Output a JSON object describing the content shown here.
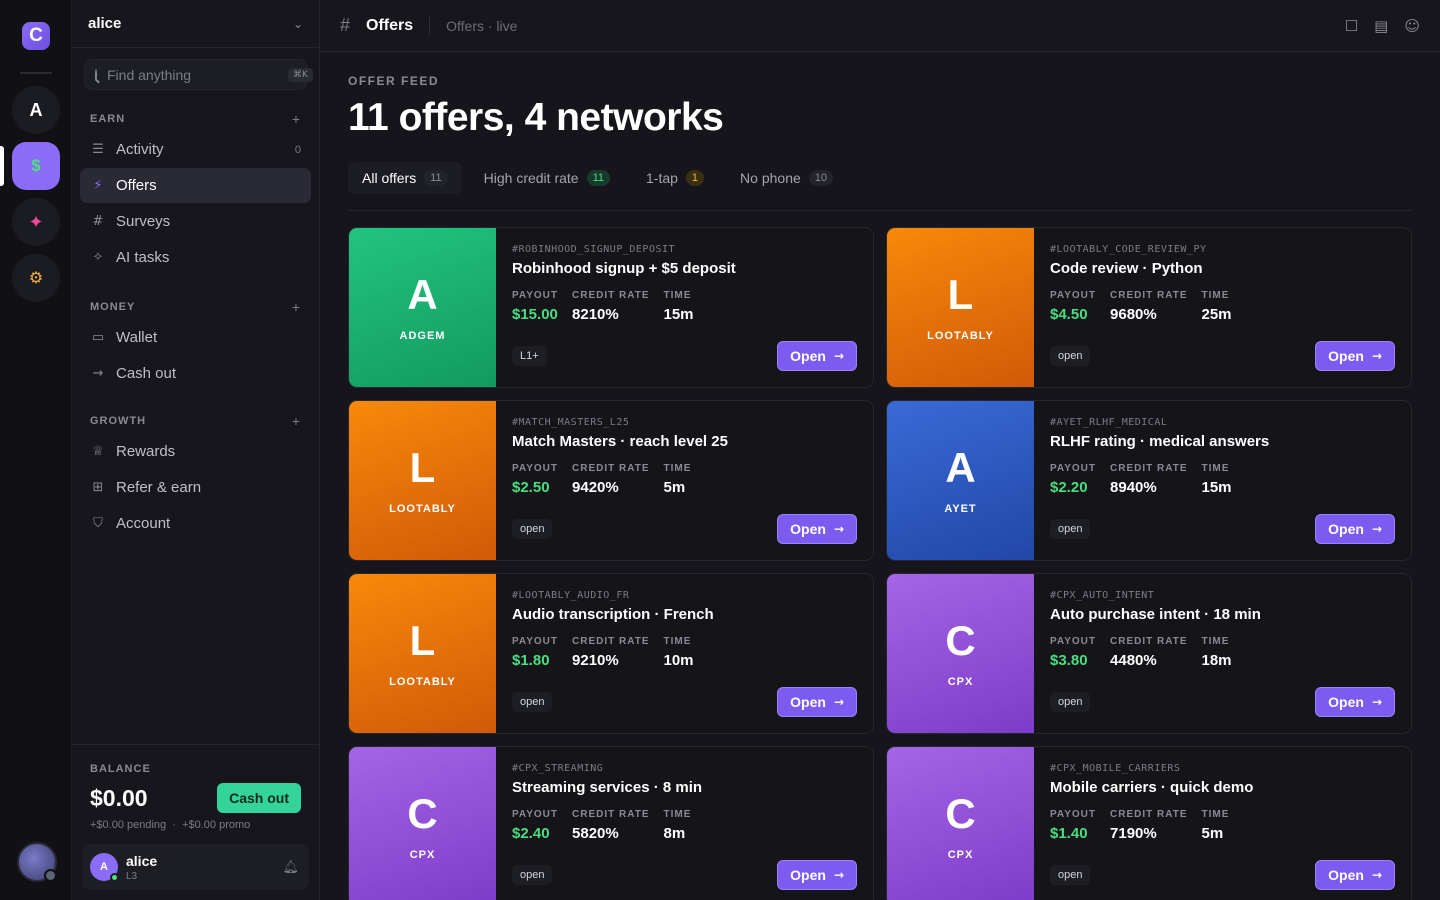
{
  "rail": {
    "logo": "C",
    "items": [
      {
        "glyph": "A"
      },
      {
        "glyph": "$"
      },
      {
        "glyph": "✦"
      },
      {
        "glyph": "⚙"
      }
    ]
  },
  "sidebar": {
    "workspace": "alice",
    "search": {
      "placeholder": "Find anything",
      "shortcut": "⌘K"
    },
    "sections": [
      {
        "label": "EARN",
        "items": [
          {
            "label": "Activity",
            "icon": "list-icon",
            "count": "0"
          },
          {
            "label": "Offers",
            "icon": "bolt-icon",
            "active": true
          },
          {
            "label": "Surveys",
            "icon": "hash-icon"
          },
          {
            "label": "AI tasks",
            "icon": "sparkle-icon"
          }
        ]
      },
      {
        "label": "MONEY",
        "items": [
          {
            "label": "Wallet",
            "icon": "wallet-icon"
          },
          {
            "label": "Cash out",
            "icon": "arrow-right-icon"
          }
        ]
      },
      {
        "label": "GROWTH",
        "items": [
          {
            "label": "Rewards",
            "icon": "trophy-icon"
          },
          {
            "label": "Refer & earn",
            "icon": "gift-icon"
          },
          {
            "label": "Account",
            "icon": "shield-icon"
          }
        ]
      }
    ],
    "balance": {
      "label": "BALANCE",
      "amount": "$0.00",
      "cashout_label": "Cash out",
      "pending": "+$0.00 pending",
      "separator": "·",
      "promo": "+$0.00 promo"
    },
    "user": {
      "initial": "A",
      "name": "alice",
      "level": "L3"
    }
  },
  "topbar": {
    "title": "Offers",
    "subtitle": "Offers · live"
  },
  "main": {
    "eyebrow": "OFFER FEED",
    "headline": "11 offers, 4 networks",
    "tabs": [
      {
        "label": "All offers",
        "count": "11",
        "active": true,
        "count_style": "neutral"
      },
      {
        "label": "High credit rate",
        "count": "11",
        "count_style": "green"
      },
      {
        "label": "1-tap",
        "count": "1",
        "count_style": "amber"
      },
      {
        "label": "No phone",
        "count": "10",
        "count_style": "neutral"
      }
    ],
    "stat_labels": {
      "payout": "PAYOUT",
      "credit_rate": "CREDIT RATE",
      "time": "TIME"
    },
    "open_label": "Open",
    "offers": [
      {
        "letter": "A",
        "network": "ADGEM",
        "color": "green",
        "slug": "#ROBINHOOD_SIGNUP_DEPOSIT",
        "title": "Robinhood signup + $5 deposit",
        "payout": "$15.00",
        "rate": "8210%",
        "time": "15m",
        "tag": "L1+"
      },
      {
        "letter": "L",
        "network": "LOOTABLY",
        "color": "orange",
        "slug": "#LOOTABLY_CODE_REVIEW_PY",
        "title": "Code review · Python",
        "payout": "$4.50",
        "rate": "9680%",
        "time": "25m",
        "tag": "open"
      },
      {
        "letter": "L",
        "network": "LOOTABLY",
        "color": "orange",
        "slug": "#MATCH_MASTERS_L25",
        "title": "Match Masters · reach level 25",
        "payout": "$2.50",
        "rate": "9420%",
        "time": "5m",
        "tag": "open"
      },
      {
        "letter": "A",
        "network": "AYET",
        "color": "blue",
        "slug": "#AYET_RLHF_MEDICAL",
        "title": "RLHF rating · medical answers",
        "payout": "$2.20",
        "rate": "8940%",
        "time": "15m",
        "tag": "open"
      },
      {
        "letter": "L",
        "network": "LOOTABLY",
        "color": "orange",
        "slug": "#LOOTABLY_AUDIO_FR",
        "title": "Audio transcription · French",
        "payout": "$1.80",
        "rate": "9210%",
        "time": "10m",
        "tag": "open"
      },
      {
        "letter": "C",
        "network": "CPX",
        "color": "purple",
        "slug": "#CPX_AUTO_INTENT",
        "title": "Auto purchase intent · 18 min",
        "payout": "$3.80",
        "rate": "4480%",
        "time": "18m",
        "tag": "open"
      },
      {
        "letter": "C",
        "network": "CPX",
        "color": "purple",
        "slug": "#CPX_STREAMING",
        "title": "Streaming services · 8 min",
        "payout": "$2.40",
        "rate": "5820%",
        "time": "8m",
        "tag": "open"
      },
      {
        "letter": "C",
        "network": "CPX",
        "color": "purple",
        "slug": "#CPX_MOBILE_CARRIERS",
        "title": "Mobile carriers · quick demo",
        "payout": "$1.40",
        "rate": "7190%",
        "time": "5m",
        "tag": "open"
      }
    ]
  }
}
